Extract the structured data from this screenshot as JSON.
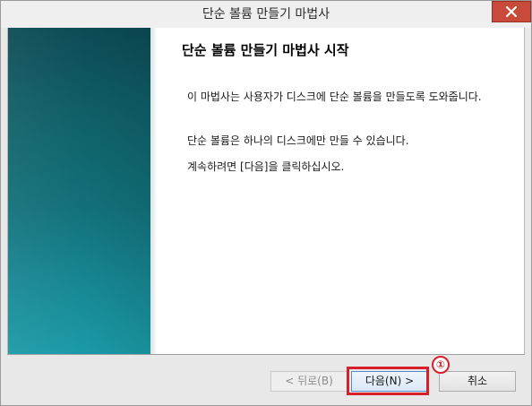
{
  "window": {
    "title": "단순 볼륨 만들기 마법사"
  },
  "wizard": {
    "heading": "단순 볼륨 만들기 마법사 시작",
    "paragraphs": [
      "이 마법사는 사용자가 디스크에 단순 볼륨을 만들도록 도와줍니다.",
      "단순 볼륨은 하나의 디스크에만 만들 수 있습니다.",
      "계속하려면 [다음]을 클릭하십시오."
    ]
  },
  "buttons": {
    "back_label": "< 뒤로(B)",
    "next_label": "다음(N) >",
    "cancel_label": "취소"
  },
  "annotation": {
    "step_number": "①",
    "color": "#d7202a"
  },
  "colors": {
    "side_panel_top": "#0d4a54",
    "side_panel_bottom": "#1a9aa6",
    "close_button": "#c74a3a"
  },
  "icons": {
    "close": "close-icon"
  }
}
